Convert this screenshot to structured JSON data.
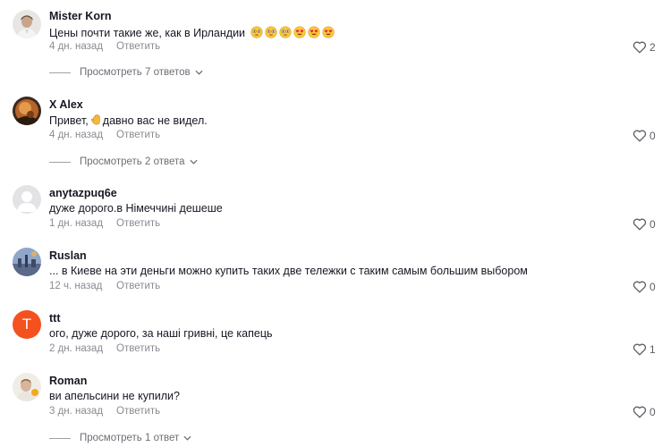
{
  "comments": [
    {
      "username": "Mister Korn",
      "text": "Цены почти такие же, как в Ирландии",
      "emojis": [
        "flushed",
        "flushed",
        "flushed",
        "heart-eyes",
        "heart-eyes",
        "heart-eyes"
      ],
      "time": "4 дн. назад",
      "reply_label": "Ответить",
      "likes": "2",
      "view_replies": "Просмотреть 7 ответов"
    },
    {
      "username": "X Alex",
      "text_before": "Привет,",
      "text_after": "давно вас не видел.",
      "emoji_inline": "waving-hand",
      "time": "4 дн. назад",
      "reply_label": "Ответить",
      "likes": "0",
      "view_replies": "Просмотреть 2 ответа"
    },
    {
      "username": "anytazpuq6e",
      "text": "дуже дорого.в Німеччині дешеше",
      "time": "1 дн. назад",
      "reply_label": "Ответить",
      "likes": "0"
    },
    {
      "username": "Ruslan",
      "text": "... в Киеве на эти деньги можно купить таких две тележки с таким самым большим выбором",
      "time": "12 ч. назад",
      "reply_label": "Ответить",
      "likes": "0"
    },
    {
      "username": "ttt",
      "avatar_letter": "T",
      "text": "ого, дуже дорого, за наші гривні, це капець",
      "time": "2 дн. назад",
      "reply_label": "Ответить",
      "likes": "1"
    },
    {
      "username": "Roman",
      "text": "ви апельсини не купили?",
      "time": "3 дн. назад",
      "reply_label": "Ответить",
      "likes": "0",
      "view_replies": "Просмотреть 1 ответ"
    }
  ],
  "colors": {
    "text": "#161823",
    "muted": "#8a8b91",
    "ttt_avatar": "#f4511e"
  },
  "icons": {
    "like": "heart-outline-icon",
    "expand": "chevron-down-icon"
  }
}
